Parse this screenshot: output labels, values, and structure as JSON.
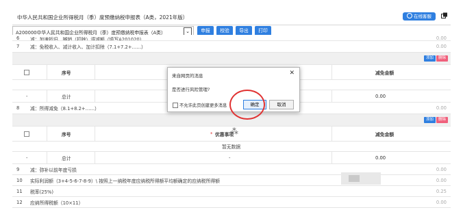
{
  "window": {
    "title": "中华人民共和国企业所得税月（季）度预缴纳税申报表（A类，2021年版）",
    "online_help": "在线客服"
  },
  "toolbar": {
    "form_select_value": "A200000中华人民共和国企业所得税月（季）度预缴纳税申报表（A类）",
    "buttons": [
      "申报",
      "校验",
      "导出",
      "打印"
    ]
  },
  "rows_top": [
    {
      "num": "6",
      "label": "减：加速折旧、摊销（扣除）调减额（填写A201020）",
      "value": "0.00"
    },
    {
      "num": "7",
      "label": "减：免税收入、减计收入、加计扣除（7.1+7.2+……）",
      "value": "0.00"
    }
  ],
  "sub_table_1": {
    "add_label": "添加",
    "delete_label": "删除",
    "headers": {
      "seq": "序号",
      "amount": "减免金额"
    },
    "total_label": "总计",
    "total_dash": "-",
    "total_value": "0.00"
  },
  "row8": {
    "num": "8",
    "label": "减：所得减免（8.1+8.2+……）",
    "value": "0.00"
  },
  "sub_table_2": {
    "add_label": "添加",
    "delete_label": "删除",
    "headers": {
      "seq": "序号",
      "item": "优惠事项",
      "amount": "减免金额"
    },
    "required_mark": "*",
    "empty_text": "暂无数据",
    "total_label": "总计",
    "total_dash": "-",
    "total_value": "0.00"
  },
  "rows_bottom": [
    {
      "num": "9",
      "label": "减：弥补以前年度亏损",
      "value": "0.00"
    },
    {
      "num": "10",
      "label": "实际利润额（3+4-5-6-7-8-9）\\ 按照上一纳税年度应纳税所得额平均额确定的应纳税所得额",
      "value": "0.00"
    },
    {
      "num": "11",
      "label": "税率(25%)",
      "value": "0.25"
    },
    {
      "num": "12",
      "label": "应纳所得税额（10×11）",
      "value": "0.00"
    }
  ],
  "dialog": {
    "title": "来自网页的消息",
    "message": "是否进行风险管理?",
    "checkbox_label": "不允许此页创建更多消息",
    "ok_label": "确定",
    "cancel_label": "取消"
  },
  "colors": {
    "accent": "#2f7fe0",
    "delete": "#f05f7b",
    "annotation": "#e03232"
  }
}
